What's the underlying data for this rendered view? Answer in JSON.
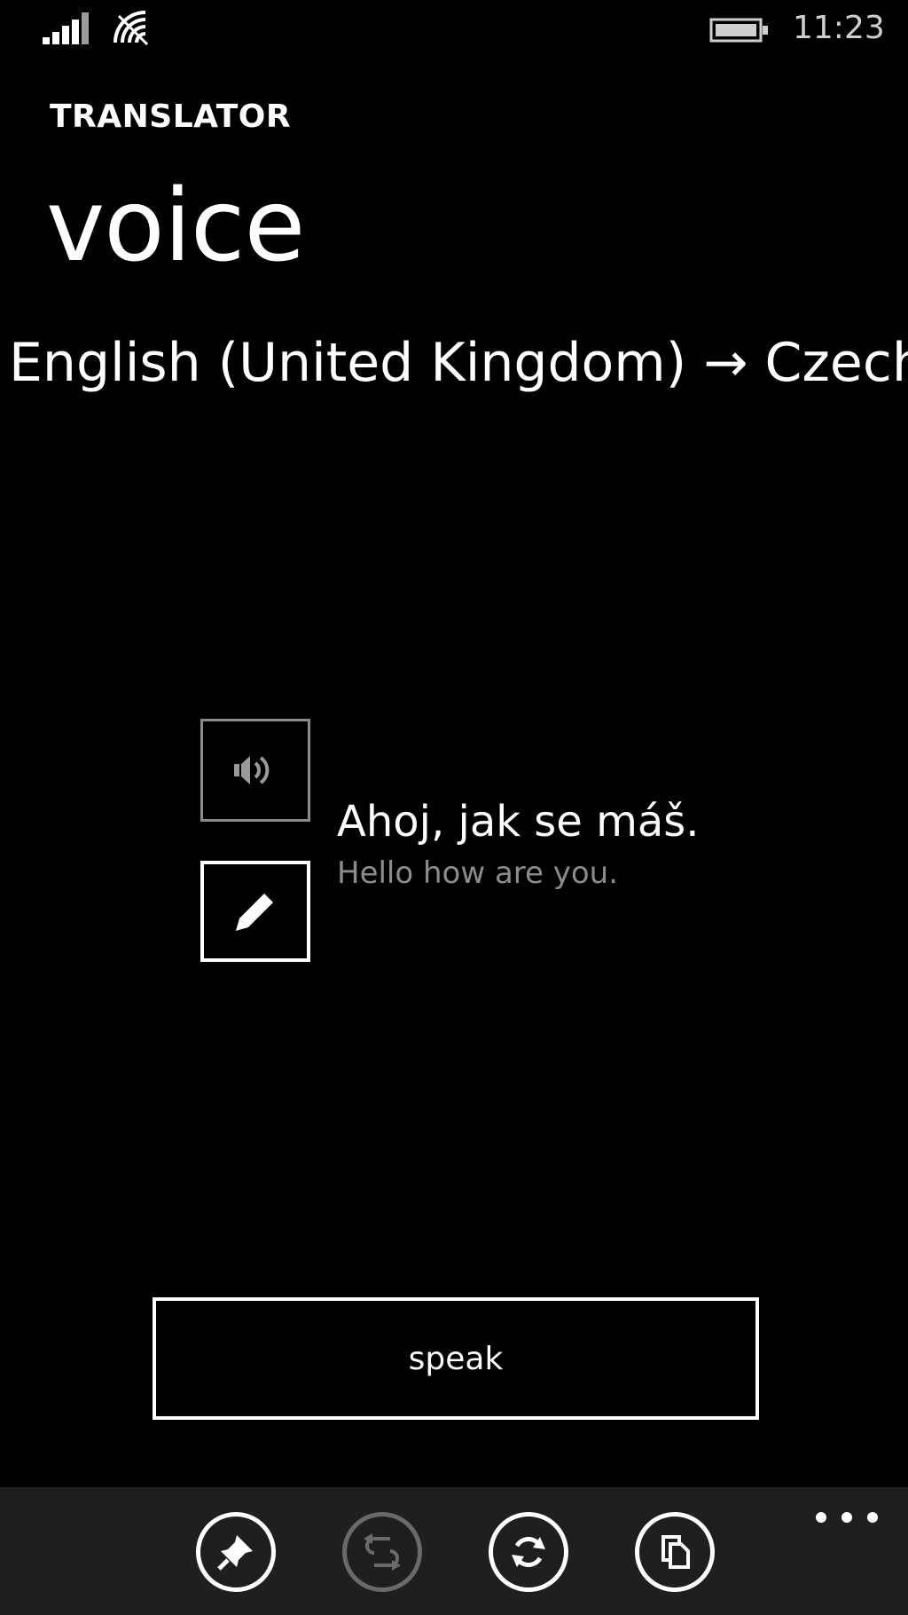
{
  "status_bar": {
    "time": "11:23",
    "icons": [
      "signal-icon",
      "wifi-icon",
      "battery-icon"
    ]
  },
  "header": {
    "app_title": "TRANSLATOR",
    "page_title": "voice",
    "language_pair": "English (United Kingdom) → Czech"
  },
  "translation": {
    "translated_text": "Ahoj, jak se máš.",
    "source_text": "Hello how are you.",
    "play_icon": "speaker-icon",
    "edit_icon": "pencil-icon"
  },
  "speak_button": {
    "label": "speak"
  },
  "app_bar": {
    "buttons": [
      {
        "name": "pin",
        "icon": "pin-icon",
        "enabled": true
      },
      {
        "name": "swap",
        "icon": "swap-arrows-icon",
        "enabled": false
      },
      {
        "name": "refresh",
        "icon": "refresh-icon",
        "enabled": true
      },
      {
        "name": "copy",
        "icon": "copy-icon",
        "enabled": true
      }
    ],
    "more_icon": "ellipsis-icon"
  },
  "colors": {
    "background": "#000000",
    "app_bar_background": "#1f1f1f",
    "foreground": "#ffffff",
    "secondary_text": "#8c8c8c",
    "disabled": "#6a6a6a"
  }
}
